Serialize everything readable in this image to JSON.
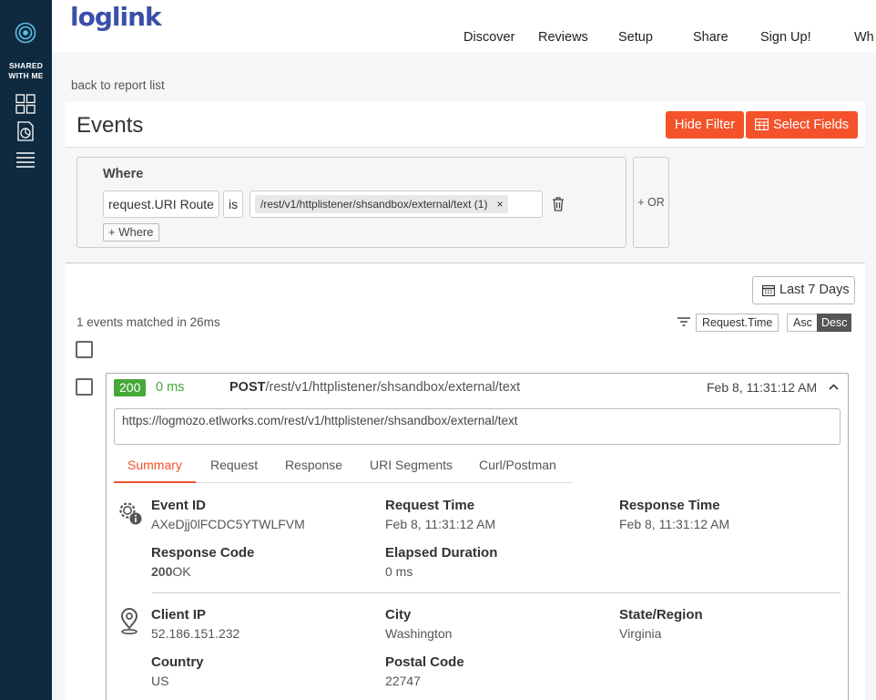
{
  "sidebar": {
    "shared_line1": "SHARED",
    "shared_line2": "WITH ME",
    "icons": [
      "target-logo-icon",
      "dashboard-grid-icon",
      "report-doc-icon",
      "list-icon"
    ]
  },
  "topbar": {
    "brand": "loglink",
    "nav": [
      "Discover",
      "Reviews",
      "Setup",
      "Share",
      "Sign Up!",
      "Wh"
    ]
  },
  "back_link": "back to report list",
  "page": {
    "title": "Events",
    "hide_filter": "Hide Filter",
    "select_fields": "Select Fields"
  },
  "filter": {
    "where_label": "Where",
    "field": "request.URI Route",
    "operator": "is",
    "value_tag": "/rest/v1/httplistener/shsandbox/external/text (1)",
    "value_remove": "×",
    "add_where": "+ Where",
    "or_label": "+ OR"
  },
  "date_range": "Last 7 Days",
  "results": {
    "matched_text": "1 events matched in 26ms",
    "sort_field": "Request.Time",
    "sort_asc": "Asc",
    "sort_desc": "Desc"
  },
  "event": {
    "status_code": "200",
    "duration": "0 ms",
    "method": "POST",
    "path": "/rest/v1/httplistener/shsandbox/external/text",
    "timestamp": "Feb 8, 11:31:12 AM",
    "url": "https://logmozo.etlworks.com/rest/v1/httplistener/shsandbox/external/text",
    "tabs": [
      "Summary",
      "Request",
      "Response",
      "URI Segments",
      "Curl/Postman"
    ],
    "active_tab": "Summary",
    "summary": {
      "event_id_label": "Event ID",
      "event_id": "AXeDjj0lFCDC5YTWLFVM",
      "request_time_label": "Request Time",
      "request_time": "Feb 8, 11:31:12 AM",
      "response_time_label": "Response Time",
      "response_time": "Feb 8, 11:31:12 AM",
      "response_code_label": "Response Code",
      "response_code": "200",
      "response_code_text": "OK",
      "elapsed_label": "Elapsed Duration",
      "elapsed": "0 ms"
    },
    "location": {
      "client_ip_label": "Client IP",
      "client_ip": "52.186.151.232",
      "city_label": "City",
      "city": "Washington",
      "state_label": "State/Region",
      "state": "Virginia",
      "country_label": "Country",
      "country": "US",
      "postal_label": "Postal Code",
      "postal": "22747"
    }
  },
  "colors": {
    "sidebar": "#0f2a3f",
    "accent": "#f3522b",
    "success": "#45a839",
    "brand": "#3a4fa8"
  }
}
